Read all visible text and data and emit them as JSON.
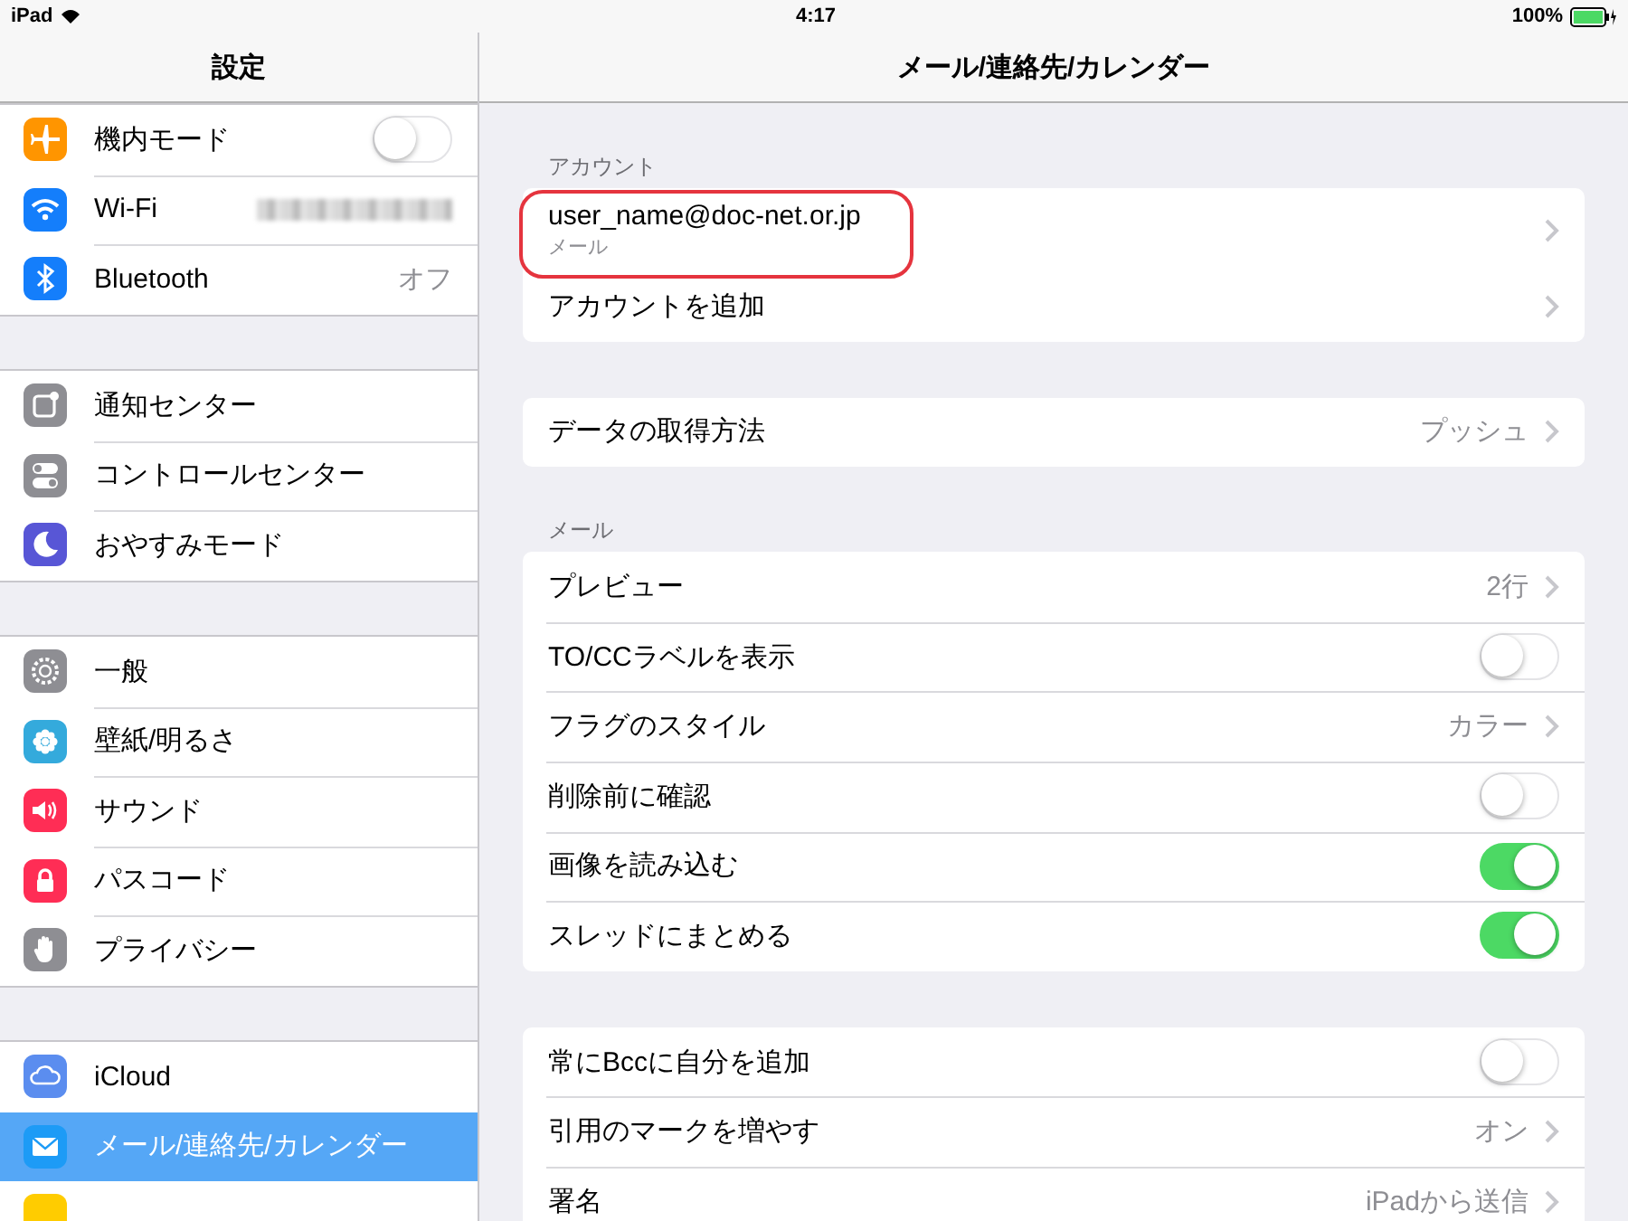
{
  "status_bar": {
    "device": "iPad",
    "time": "4:17",
    "battery": "100%"
  },
  "sidebar": {
    "title": "設定",
    "groups": [
      [
        {
          "label": "機内モード",
          "kind": "toggle",
          "on": false,
          "selected": false,
          "color": "#ff9500"
        },
        {
          "label": "Wi-Fi",
          "kind": "blurred",
          "selected": false,
          "color": "#147efb"
        },
        {
          "label": "Bluetooth",
          "kind": "value",
          "value": "オフ",
          "selected": false,
          "color": "#147efb"
        }
      ],
      [
        {
          "label": "通知センター",
          "kind": "plain",
          "selected": false,
          "color": "#8e8e93"
        },
        {
          "label": "コントロールセンター",
          "kind": "plain",
          "selected": false,
          "color": "#8e8e93"
        },
        {
          "label": "おやすみモード",
          "kind": "plain",
          "selected": false,
          "color": "#5856d6"
        }
      ],
      [
        {
          "label": "一般",
          "kind": "plain",
          "selected": false,
          "color": "#8e8e93"
        },
        {
          "label": "壁紙/明るさ",
          "kind": "plain",
          "selected": false,
          "color": "#34aadc"
        },
        {
          "label": "サウンド",
          "kind": "plain",
          "selected": false,
          "color": "#ff2d55"
        },
        {
          "label": "パスコード",
          "kind": "plain",
          "selected": false,
          "color": "#ff2d55"
        },
        {
          "label": "プライバシー",
          "kind": "plain",
          "selected": false,
          "color": "#8e8e93"
        }
      ],
      [
        {
          "label": "iCloud",
          "kind": "plain",
          "selected": false,
          "color": "#5b8def"
        },
        {
          "label": "メール/連絡先/カレンダー",
          "kind": "plain",
          "selected": true,
          "color": "#1d9bf6"
        },
        {
          "kind": "cut",
          "selected": false,
          "color": "#ffcc00"
        }
      ]
    ]
  },
  "detail": {
    "title": "メール/連絡先/カレンダー",
    "sections": [
      {
        "header": "アカウント",
        "rows": [
          {
            "kind": "account",
            "title": "user_name@doc-net.or.jp",
            "subtitle": "メール",
            "highlighted": true
          },
          {
            "kind": "link",
            "label": "アカウントを追加"
          }
        ]
      },
      {
        "rows": [
          {
            "kind": "link",
            "label": "データの取得方法",
            "value": "プッシュ"
          }
        ]
      },
      {
        "header": "メール",
        "rows": [
          {
            "kind": "link",
            "label": "プレビュー",
            "value": "2行"
          },
          {
            "kind": "toggle",
            "label": "TO/CCラベルを表示",
            "on": false
          },
          {
            "kind": "link",
            "label": "フラグのスタイル",
            "value": "カラー"
          },
          {
            "kind": "toggle",
            "label": "削除前に確認",
            "on": false
          },
          {
            "kind": "toggle",
            "label": "画像を読み込む",
            "on": true
          },
          {
            "kind": "toggle",
            "label": "スレッドにまとめる",
            "on": true
          }
        ]
      },
      {
        "rows": [
          {
            "kind": "toggle",
            "label": "常にBccに自分を追加",
            "on": false
          },
          {
            "kind": "link",
            "label": "引用のマークを増やす",
            "value": "オン"
          },
          {
            "kind": "link",
            "label": "署名",
            "value": "iPadから送信"
          }
        ]
      }
    ]
  }
}
